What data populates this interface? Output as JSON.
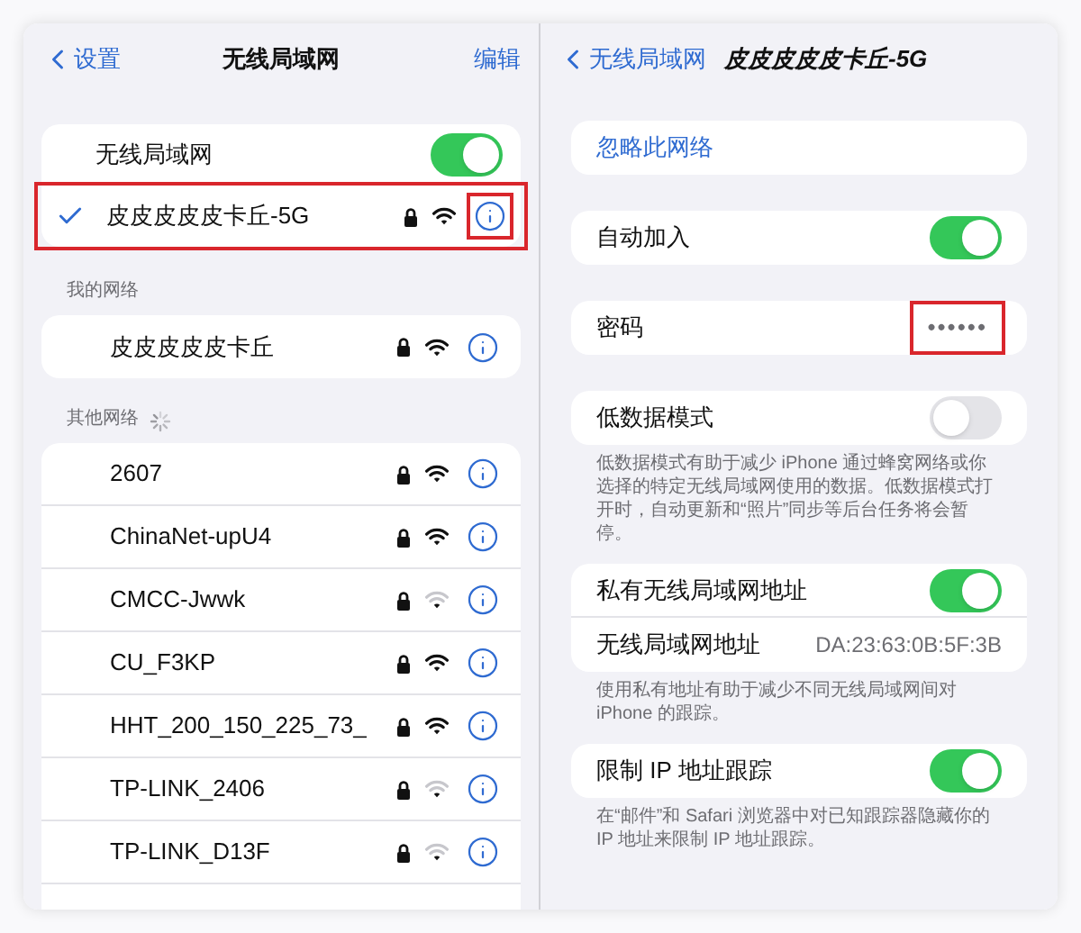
{
  "left_screen": {
    "back": "设置",
    "title": "无线局域网",
    "edit": "编辑",
    "wifi_toggle": {
      "label": "无线局域网",
      "on": true
    },
    "connected": {
      "name": "皮皮皮皮皮卡丘-5G",
      "selected": true,
      "highlighted": true,
      "info_highlighted": true,
      "weak_signal": false
    },
    "my_networks": {
      "header": "我的网络",
      "items": [
        {
          "name": "皮皮皮皮皮卡丘",
          "weak_signal": false
        }
      ]
    },
    "other_networks": {
      "header": "其他网络",
      "items": [
        {
          "name": "2607",
          "weak_signal": false
        },
        {
          "name": "ChinaNet-upU4",
          "weak_signal": false
        },
        {
          "name": "CMCC-Jwwk",
          "weak_signal": true
        },
        {
          "name": "CU_F3KP",
          "weak_signal": false
        },
        {
          "name": "HHT_200_150_225_73_",
          "weak_signal": false
        },
        {
          "name": "TP-LINK_2406",
          "weak_signal": true
        },
        {
          "name": "TP-LINK_D13F",
          "weak_signal": true
        }
      ]
    }
  },
  "right_screen": {
    "back": "无线局域网",
    "title": "皮皮皮皮皮卡丘-5G",
    "sections": [
      {
        "rows": [
          {
            "kind": "action",
            "label": "忽略此网络"
          }
        ]
      },
      {
        "rows": [
          {
            "kind": "toggle",
            "label": "自动加入",
            "on": true
          }
        ]
      },
      {
        "rows": [
          {
            "kind": "password",
            "label": "密码",
            "value": "••••••",
            "highlighted": true
          }
        ]
      },
      {
        "rows": [
          {
            "kind": "toggle",
            "label": "低数据模式",
            "on": false
          }
        ],
        "footer": "低数据模式有助于减少 iPhone 通过蜂窝网络或你选择的特定无线局域网使用的数据。低数据模式打开时，自动更新和“照片”同步等后台任务将会暂停。"
      },
      {
        "rows": [
          {
            "kind": "toggle",
            "label": "私有无线局域网地址",
            "on": true
          },
          {
            "kind": "value",
            "label": "无线局域网地址",
            "value": "DA:23:63:0B:5F:3B"
          }
        ],
        "footer": "使用私有地址有助于减少不同无线局域网间对 iPhone 的跟踪。"
      },
      {
        "rows": [
          {
            "kind": "toggle",
            "label": "限制 IP 地址跟踪",
            "on": true
          }
        ],
        "footer": "在“邮件”和 Safari 浏览器中对已知跟踪器隐藏你的 IP 地址来限制 IP 地址跟踪。"
      }
    ]
  }
}
